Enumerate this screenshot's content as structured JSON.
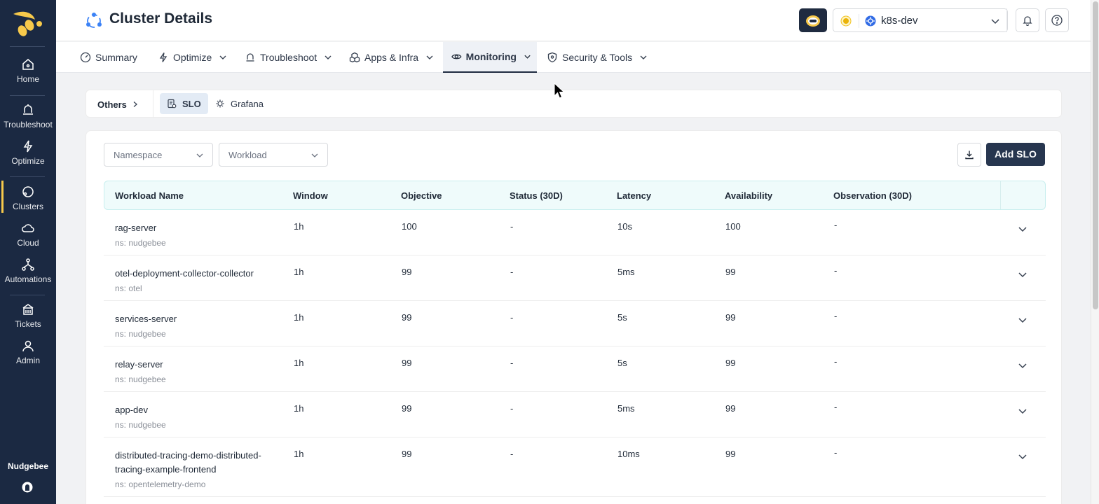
{
  "sidebar": {
    "items": [
      {
        "label": "Home",
        "icon": "home-icon"
      },
      {
        "label": "Troubleshoot",
        "icon": "troubleshoot-icon"
      },
      {
        "label": "Optimize",
        "icon": "bolt-icon"
      },
      {
        "label": "Clusters",
        "icon": "clusters-icon",
        "active": true
      },
      {
        "label": "Cloud",
        "icon": "cloud-icon"
      },
      {
        "label": "Automations",
        "icon": "automations-icon"
      },
      {
        "label": "Tickets",
        "icon": "tickets-icon"
      },
      {
        "label": "Admin",
        "icon": "admin-icon"
      }
    ],
    "brand": "Nudgebee"
  },
  "header": {
    "title": "Cluster Details",
    "cluster_name": "k8s-dev"
  },
  "tabs": [
    {
      "label": "Summary"
    },
    {
      "label": "Optimize"
    },
    {
      "label": "Troubleshoot"
    },
    {
      "label": "Apps & Infra"
    },
    {
      "label": "Monitoring",
      "active": true
    },
    {
      "label": "Security & Tools"
    }
  ],
  "subnav": {
    "others": "Others",
    "items": [
      {
        "label": "SLO",
        "active": true
      },
      {
        "label": "Grafana"
      }
    ]
  },
  "filters": {
    "namespace": "Namespace",
    "workload": "Workload"
  },
  "actions": {
    "add": "Add SLO"
  },
  "table": {
    "columns": [
      "Workload Name",
      "Window",
      "Objective",
      "Status (30D)",
      "Latency",
      "Availability",
      "Observation (30D)"
    ],
    "rows": [
      {
        "name": "rag-server",
        "ns": "ns: nudgebee",
        "window": "1h",
        "objective": "100",
        "status": "-",
        "latency": "10s",
        "availability": "100",
        "observation": "-"
      },
      {
        "name": "otel-deployment-collector-collector",
        "ns": "ns: otel",
        "window": "1h",
        "objective": "99",
        "status": "-",
        "latency": "5ms",
        "availability": "99",
        "observation": "-"
      },
      {
        "name": "services-server",
        "ns": "ns: nudgebee",
        "window": "1h",
        "objective": "99",
        "status": "-",
        "latency": "5s",
        "availability": "99",
        "observation": "-"
      },
      {
        "name": "relay-server",
        "ns": "ns: nudgebee",
        "window": "1h",
        "objective": "99",
        "status": "-",
        "latency": "5s",
        "availability": "99",
        "observation": "-"
      },
      {
        "name": "app-dev",
        "ns": "ns: nudgebee",
        "window": "1h",
        "objective": "99",
        "status": "-",
        "latency": "5ms",
        "availability": "99",
        "observation": "-"
      },
      {
        "name": "distributed-tracing-demo-distributed-tracing-example-frontend",
        "ns": "ns: opentelemetry-demo",
        "window": "1h",
        "objective": "99",
        "status": "-",
        "latency": "10ms",
        "availability": "99",
        "observation": "-"
      }
    ]
  },
  "colors": {
    "sidebar_bg": "#1b2942",
    "accent_yellow": "#f7c94b",
    "primary_button": "#27364f",
    "table_header_bg": "#effbfb"
  }
}
